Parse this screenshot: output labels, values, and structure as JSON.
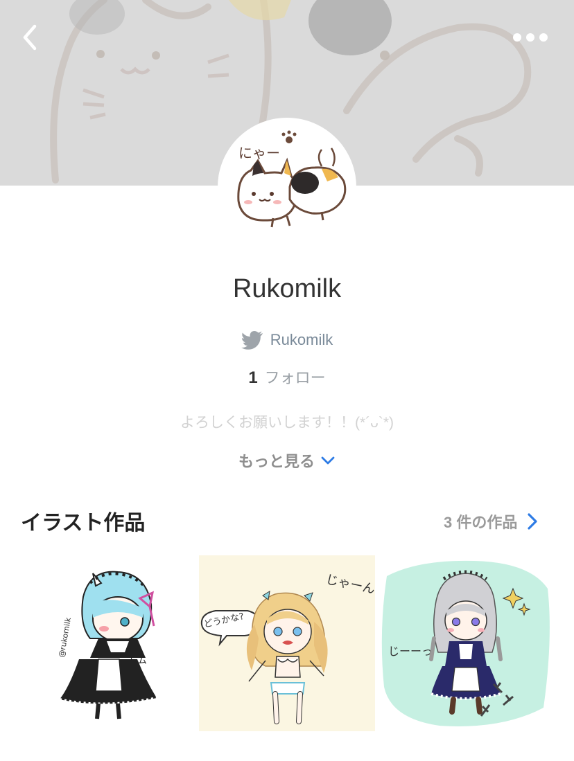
{
  "header": {
    "back_icon": "chevron-left-icon",
    "more_icon": "more-dots-icon"
  },
  "profile": {
    "name": "Rukomilk",
    "twitter_icon": "twitter-icon",
    "twitter_handle": "Rukomilk",
    "follow_count": "1",
    "follow_label": "フォロー",
    "bio": "よろしくお願いします！！(*´ᴗ`*)",
    "more_label": "もっと見る",
    "avatar_text": "にゃー"
  },
  "illustrations": {
    "title": "イラスト作品",
    "count_label": "3 件の作品",
    "items": [
      {
        "signature": "@rukomilk",
        "caption": "レム"
      },
      {
        "speech": "どうかな?",
        "side_text": "じゃーん"
      },
      {
        "side_text": "じーーっ"
      }
    ]
  },
  "colors": {
    "accent": "#2d7be5",
    "header_bg": "#dadada",
    "muted_text": "#9a9a9a"
  }
}
